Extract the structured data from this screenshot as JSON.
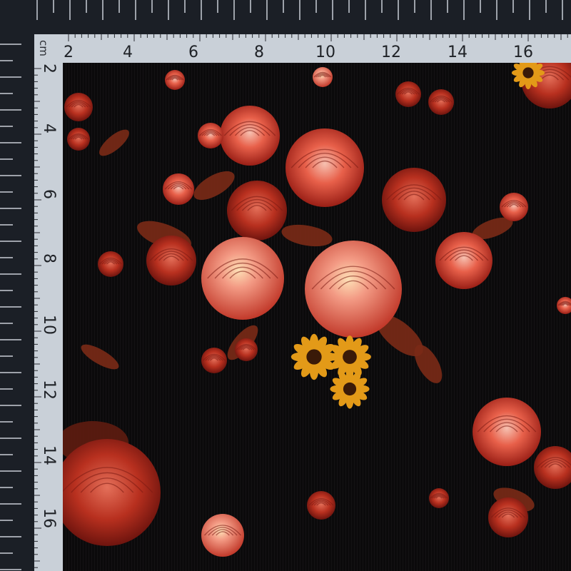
{
  "ruler": {
    "unit_label": "cm",
    "top_labels": [
      "2",
      "4",
      "6",
      "8",
      "10",
      "12",
      "14",
      "16"
    ],
    "left_labels": [
      "2",
      "4",
      "6",
      "8",
      "10",
      "12",
      "14",
      "16"
    ]
  },
  "colors": {
    "outer_ruler": "#1b1f26",
    "outer_tick": "#c9ced6",
    "inner_ruler": "#c9d0d8",
    "inner_tick": "#2a2d33",
    "fabric": "#0b0a0b",
    "rose_dark": "#a8261c",
    "rose_mid": "#d9473a",
    "rose_light": "#f08a74",
    "rose_pale": "#f6c0b0",
    "leaf": "#7a2a16",
    "sunflower": "#e39a18",
    "sunflower_center": "#3a1a08"
  }
}
